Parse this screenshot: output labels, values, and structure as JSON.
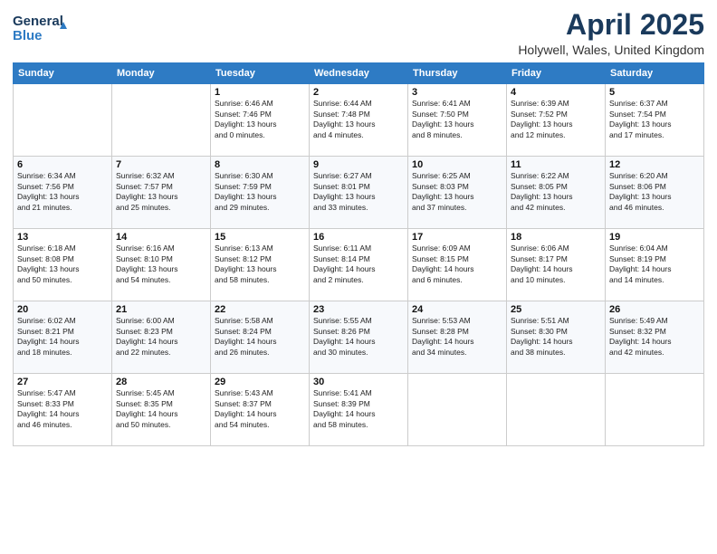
{
  "header": {
    "logo_line1": "General",
    "logo_line2": "Blue",
    "month_title": "April 2025",
    "location": "Holywell, Wales, United Kingdom"
  },
  "days_of_week": [
    "Sunday",
    "Monday",
    "Tuesday",
    "Wednesday",
    "Thursday",
    "Friday",
    "Saturday"
  ],
  "weeks": [
    [
      {
        "day": "",
        "info": ""
      },
      {
        "day": "",
        "info": ""
      },
      {
        "day": "1",
        "info": "Sunrise: 6:46 AM\nSunset: 7:46 PM\nDaylight: 13 hours\nand 0 minutes."
      },
      {
        "day": "2",
        "info": "Sunrise: 6:44 AM\nSunset: 7:48 PM\nDaylight: 13 hours\nand 4 minutes."
      },
      {
        "day": "3",
        "info": "Sunrise: 6:41 AM\nSunset: 7:50 PM\nDaylight: 13 hours\nand 8 minutes."
      },
      {
        "day": "4",
        "info": "Sunrise: 6:39 AM\nSunset: 7:52 PM\nDaylight: 13 hours\nand 12 minutes."
      },
      {
        "day": "5",
        "info": "Sunrise: 6:37 AM\nSunset: 7:54 PM\nDaylight: 13 hours\nand 17 minutes."
      }
    ],
    [
      {
        "day": "6",
        "info": "Sunrise: 6:34 AM\nSunset: 7:56 PM\nDaylight: 13 hours\nand 21 minutes."
      },
      {
        "day": "7",
        "info": "Sunrise: 6:32 AM\nSunset: 7:57 PM\nDaylight: 13 hours\nand 25 minutes."
      },
      {
        "day": "8",
        "info": "Sunrise: 6:30 AM\nSunset: 7:59 PM\nDaylight: 13 hours\nand 29 minutes."
      },
      {
        "day": "9",
        "info": "Sunrise: 6:27 AM\nSunset: 8:01 PM\nDaylight: 13 hours\nand 33 minutes."
      },
      {
        "day": "10",
        "info": "Sunrise: 6:25 AM\nSunset: 8:03 PM\nDaylight: 13 hours\nand 37 minutes."
      },
      {
        "day": "11",
        "info": "Sunrise: 6:22 AM\nSunset: 8:05 PM\nDaylight: 13 hours\nand 42 minutes."
      },
      {
        "day": "12",
        "info": "Sunrise: 6:20 AM\nSunset: 8:06 PM\nDaylight: 13 hours\nand 46 minutes."
      }
    ],
    [
      {
        "day": "13",
        "info": "Sunrise: 6:18 AM\nSunset: 8:08 PM\nDaylight: 13 hours\nand 50 minutes."
      },
      {
        "day": "14",
        "info": "Sunrise: 6:16 AM\nSunset: 8:10 PM\nDaylight: 13 hours\nand 54 minutes."
      },
      {
        "day": "15",
        "info": "Sunrise: 6:13 AM\nSunset: 8:12 PM\nDaylight: 13 hours\nand 58 minutes."
      },
      {
        "day": "16",
        "info": "Sunrise: 6:11 AM\nSunset: 8:14 PM\nDaylight: 14 hours\nand 2 minutes."
      },
      {
        "day": "17",
        "info": "Sunrise: 6:09 AM\nSunset: 8:15 PM\nDaylight: 14 hours\nand 6 minutes."
      },
      {
        "day": "18",
        "info": "Sunrise: 6:06 AM\nSunset: 8:17 PM\nDaylight: 14 hours\nand 10 minutes."
      },
      {
        "day": "19",
        "info": "Sunrise: 6:04 AM\nSunset: 8:19 PM\nDaylight: 14 hours\nand 14 minutes."
      }
    ],
    [
      {
        "day": "20",
        "info": "Sunrise: 6:02 AM\nSunset: 8:21 PM\nDaylight: 14 hours\nand 18 minutes."
      },
      {
        "day": "21",
        "info": "Sunrise: 6:00 AM\nSunset: 8:23 PM\nDaylight: 14 hours\nand 22 minutes."
      },
      {
        "day": "22",
        "info": "Sunrise: 5:58 AM\nSunset: 8:24 PM\nDaylight: 14 hours\nand 26 minutes."
      },
      {
        "day": "23",
        "info": "Sunrise: 5:55 AM\nSunset: 8:26 PM\nDaylight: 14 hours\nand 30 minutes."
      },
      {
        "day": "24",
        "info": "Sunrise: 5:53 AM\nSunset: 8:28 PM\nDaylight: 14 hours\nand 34 minutes."
      },
      {
        "day": "25",
        "info": "Sunrise: 5:51 AM\nSunset: 8:30 PM\nDaylight: 14 hours\nand 38 minutes."
      },
      {
        "day": "26",
        "info": "Sunrise: 5:49 AM\nSunset: 8:32 PM\nDaylight: 14 hours\nand 42 minutes."
      }
    ],
    [
      {
        "day": "27",
        "info": "Sunrise: 5:47 AM\nSunset: 8:33 PM\nDaylight: 14 hours\nand 46 minutes."
      },
      {
        "day": "28",
        "info": "Sunrise: 5:45 AM\nSunset: 8:35 PM\nDaylight: 14 hours\nand 50 minutes."
      },
      {
        "day": "29",
        "info": "Sunrise: 5:43 AM\nSunset: 8:37 PM\nDaylight: 14 hours\nand 54 minutes."
      },
      {
        "day": "30",
        "info": "Sunrise: 5:41 AM\nSunset: 8:39 PM\nDaylight: 14 hours\nand 58 minutes."
      },
      {
        "day": "",
        "info": ""
      },
      {
        "day": "",
        "info": ""
      },
      {
        "day": "",
        "info": ""
      }
    ]
  ]
}
